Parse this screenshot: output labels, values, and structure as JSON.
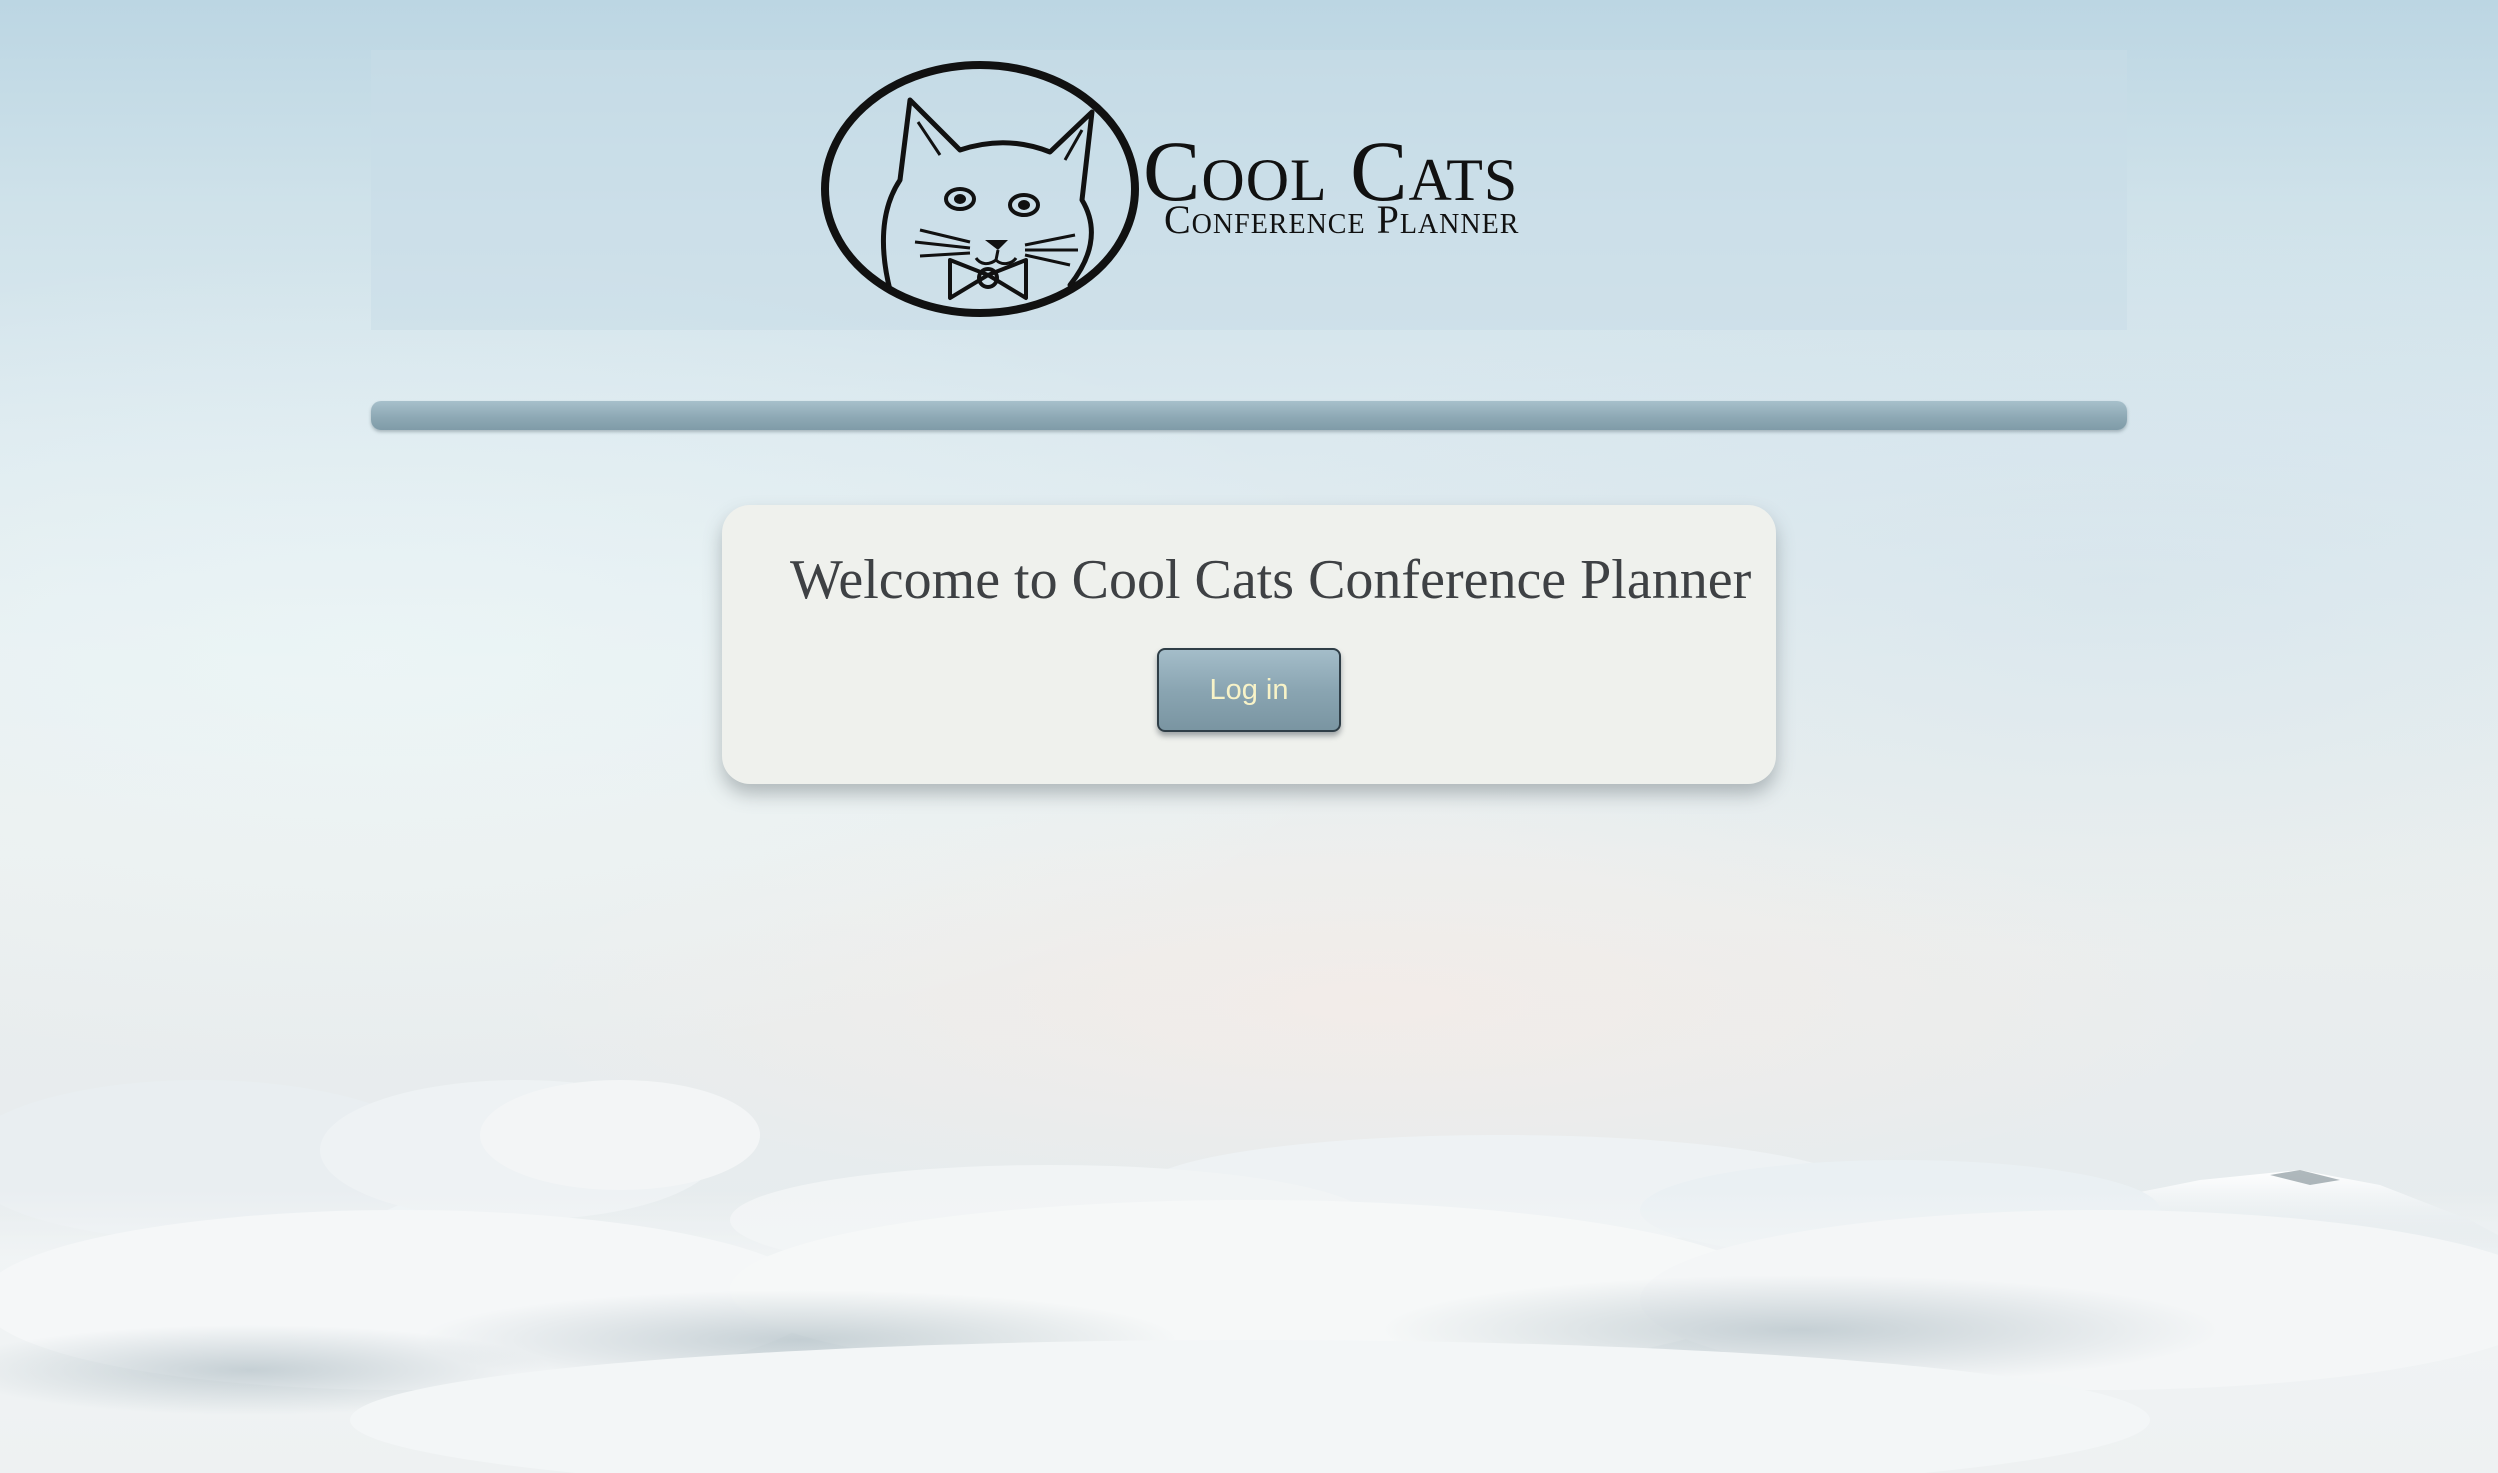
{
  "header": {
    "logo_title": "Cool Cats",
    "logo_subtitle": "Conference Planner",
    "logo_icon": "cat-with-bowtie-icon"
  },
  "main": {
    "welcome_text": "Welcome to Cool Cats Conference Planner",
    "login_label": "Log in"
  },
  "colors": {
    "button_text": "#f8f3c8",
    "button_bg": "#8aa5b2",
    "card_bg": "#eff1ed",
    "divider": "#8ea9b5"
  }
}
